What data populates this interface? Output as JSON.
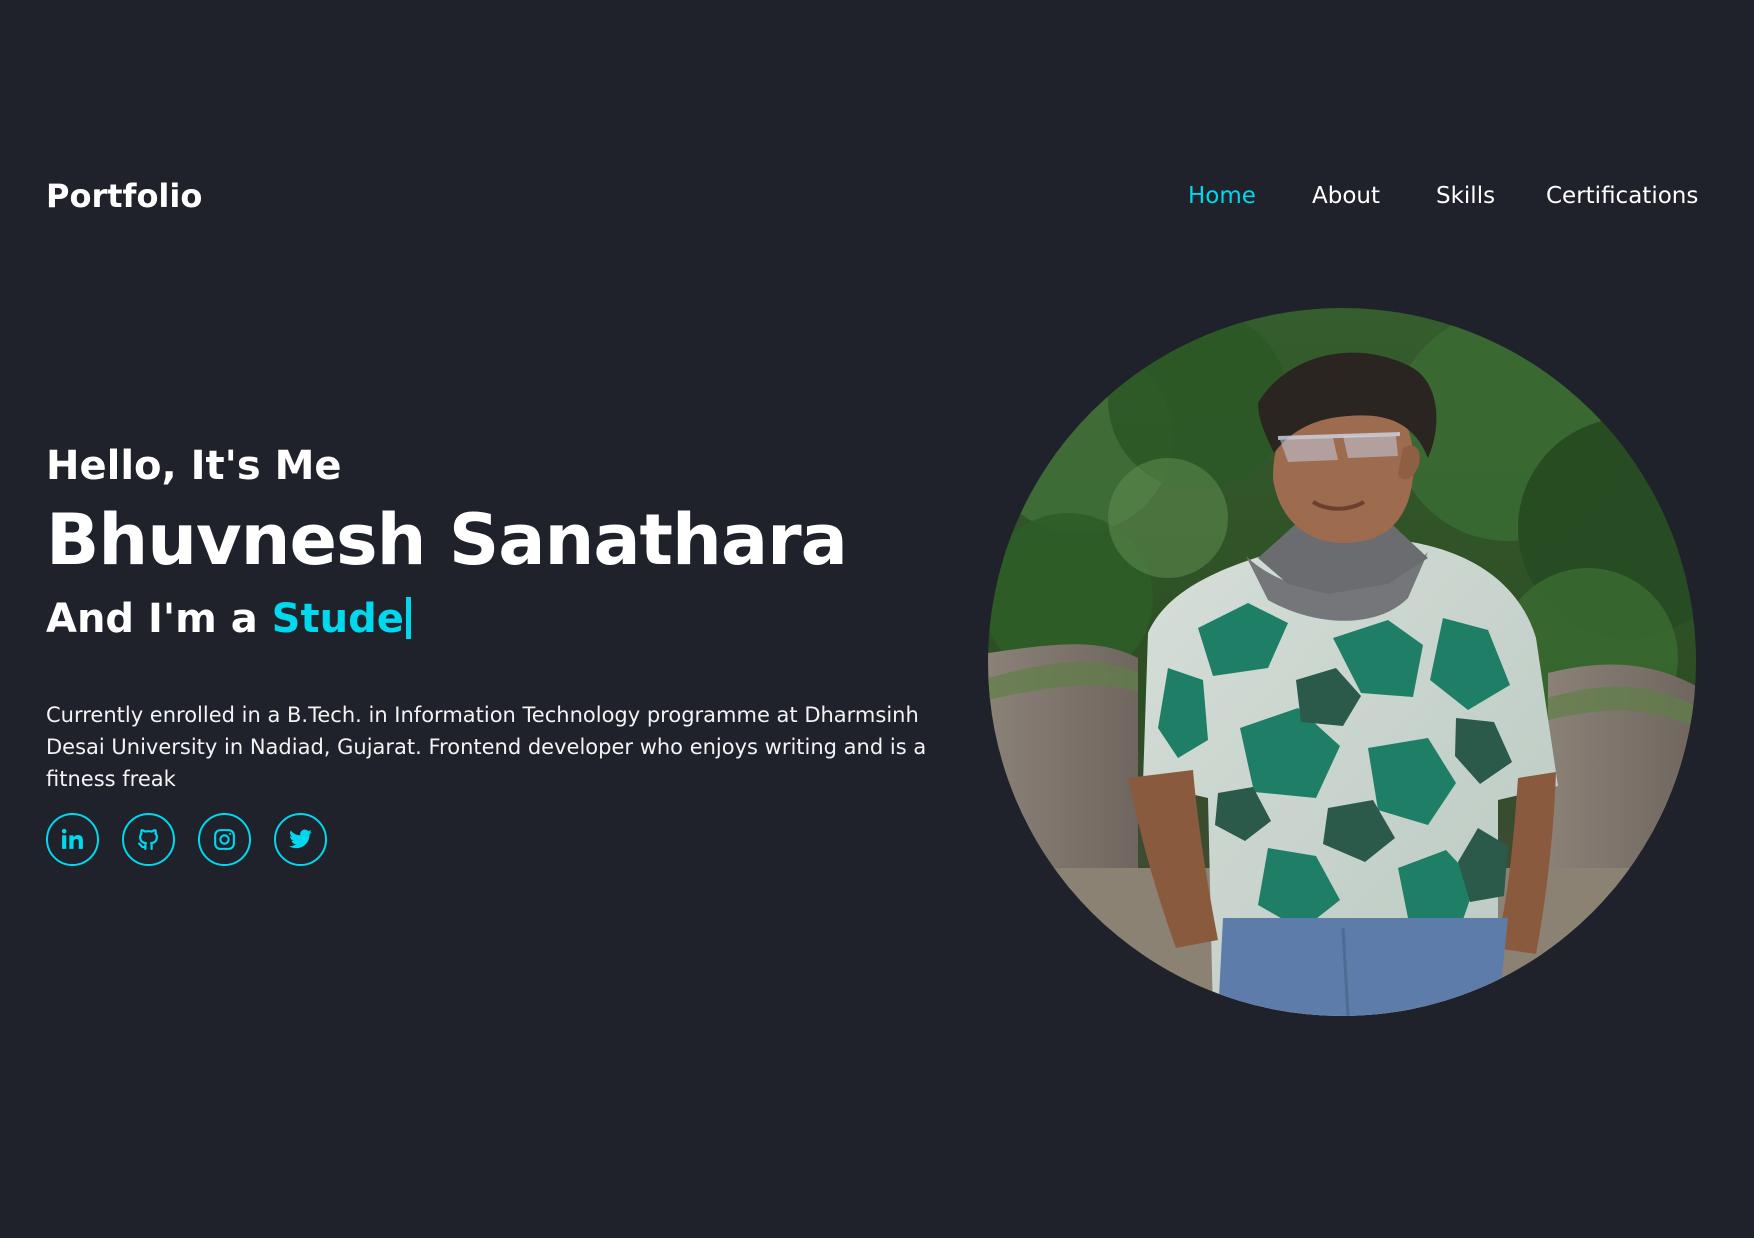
{
  "header": {
    "logo": "Portfolio",
    "nav": [
      {
        "label": "Home",
        "active": true
      },
      {
        "label": "About",
        "active": false
      },
      {
        "label": "Skills",
        "active": false
      },
      {
        "label": "Certifications",
        "active": false
      }
    ]
  },
  "hero": {
    "greeting": "Hello, It's Me",
    "name": "Bhuvnesh Sanathara",
    "role_prefix": "And I'm a ",
    "role_typed": "Stude",
    "description": "Currently enrolled in a B.Tech. in Information Technology programme at Dharmsinh Desai University in Nadiad, Gujarat. Frontend developer who enjoys writing and is a fitness freak",
    "social_icons": [
      "linkedin-icon",
      "github-icon",
      "instagram-icon",
      "twitter-icon"
    ]
  },
  "theme": {
    "background": "#1f222b",
    "accent": "#00d8ee",
    "text": "#ffffff"
  }
}
